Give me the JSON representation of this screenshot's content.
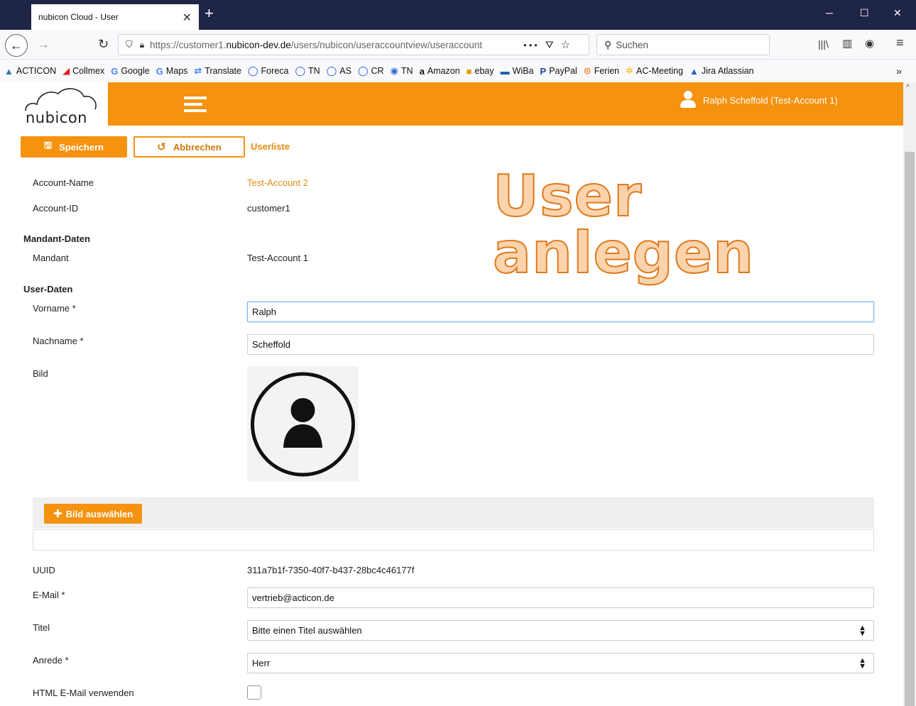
{
  "browser": {
    "tab_title": "nubicon Cloud - User",
    "url_prefix": "https://customer1.",
    "url_domain": "nubicon-dev.de",
    "url_path": "/users/nubicon/useraccountview/useraccount",
    "search_placeholder": "Suchen",
    "bookmarks": [
      {
        "label": "ACTICON",
        "icon": "acticon-icon",
        "color": "#2a7ab0"
      },
      {
        "label": "Collmex",
        "icon": "collmex-icon",
        "color": "#e02020"
      },
      {
        "label": "Google",
        "icon": "google-icon",
        "color": "#4285f4"
      },
      {
        "label": "Maps",
        "icon": "google-icon",
        "color": "#4285f4"
      },
      {
        "label": "Translate",
        "icon": "translate-icon",
        "color": "#4285f4"
      },
      {
        "label": "Foreca",
        "icon": "circle-icon",
        "color": "#1a4fd0"
      },
      {
        "label": "TN",
        "icon": "circle-icon",
        "color": "#1a4fd0"
      },
      {
        "label": "AS",
        "icon": "circle-icon",
        "color": "#1a4fd0"
      },
      {
        "label": "CR",
        "icon": "circle-icon",
        "color": "#1a4fd0"
      },
      {
        "label": "TN",
        "icon": "globe-icon",
        "color": "#2a6ad0"
      },
      {
        "label": "Amazon",
        "icon": "amazon-icon",
        "color": "#111111"
      },
      {
        "label": "ebay",
        "icon": "bag-icon",
        "color": "#e0a000"
      },
      {
        "label": "WiBa",
        "icon": "bank-icon",
        "color": "#1a5fb0"
      },
      {
        "label": "PayPal",
        "icon": "paypal-icon",
        "color": "#1a3f9a"
      },
      {
        "label": "Ferien",
        "icon": "ferien-icon",
        "color": "#f07820"
      },
      {
        "label": "AC-Meeting",
        "icon": "gear-icon",
        "color": "#f5b400"
      },
      {
        "label": "Jira Atlassian",
        "icon": "jira-icon",
        "color": "#2060d0"
      }
    ]
  },
  "app": {
    "logo_text": "nubicon",
    "user_label": "Ralph Scheffold (Test-Account 1)",
    "brand_color": "#f5920f"
  },
  "toolbar": {
    "save_label": "Speichern",
    "cancel_label": "Abbrechen",
    "userlist_label": "Userliste"
  },
  "overlay_title": "User anlegen",
  "account": {
    "name_label": "Account-Name",
    "name_value": "Test-Account 2",
    "id_label": "Account-ID",
    "id_value": "customer1"
  },
  "mandant": {
    "section_title": "Mandant-Daten",
    "label": "Mandant",
    "value": "Test-Account 1"
  },
  "user": {
    "section_title": "User-Daten",
    "vorname_label": "Vorname",
    "vorname_value": "Ralph",
    "nachname_label": "Nachname",
    "nachname_value": "Scheffold",
    "bild_label": "Bild",
    "bild_button": "Bild auswählen",
    "uuid_label": "UUID",
    "uuid_value": "311a7b1f-7350-40f7-b437-28bc4c46177f",
    "email_label": "E-Mail",
    "email_value": "vertrieb@acticon.de",
    "titel_label": "Titel",
    "titel_value": "Bitte einen Titel auswählen",
    "anrede_label": "Anrede",
    "anrede_value": "Herr",
    "html_email_label": "HTML E-Mail verwenden",
    "html_email_checked": false,
    "required_marker": "*"
  }
}
